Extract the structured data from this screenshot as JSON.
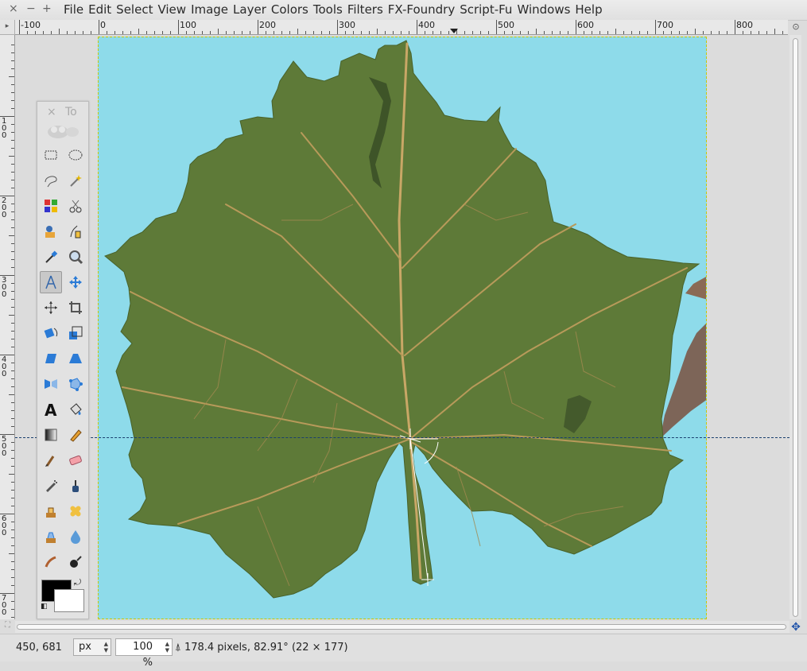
{
  "window_controls": [
    "×",
    "−",
    "+"
  ],
  "menu": [
    "File",
    "Edit",
    "Select",
    "View",
    "Image",
    "Layer",
    "Colors",
    "Tools",
    "Filters",
    "FX-Foundry",
    "Script-Fu",
    "Windows",
    "Help"
  ],
  "hruler_labels": [
    "-100",
    "0",
    "100",
    "200",
    "300",
    "400",
    "500",
    "600",
    "700",
    "800"
  ],
  "vruler_labels": [
    "100",
    "200",
    "300",
    "400",
    "500",
    "600",
    "700"
  ],
  "toolbox": {
    "close": "×",
    "title": "To",
    "tools": [
      "rect-select-tool-icon",
      "ellipse-select-tool-icon",
      "free-select-tool-icon",
      "fuzzy-select-tool-icon",
      "select-by-color-tool-icon",
      "scissors-select-tool-icon",
      "foreground-select-tool-icon",
      "paths-tool-icon",
      "color-picker-tool-icon",
      "zoom-tool-icon",
      "measure-tool-icon",
      "move-tool-icon",
      "align-tool-icon",
      "crop-tool-icon",
      "rotate-tool-icon",
      "scale-tool-icon",
      "shear-tool-icon",
      "perspective-tool-icon",
      "flip-tool-icon",
      "cage-transform-tool-icon",
      "text-tool-icon",
      "bucket-fill-tool-icon",
      "blend-tool-icon",
      "pencil-tool-icon",
      "paintbrush-tool-icon",
      "eraser-tool-icon",
      "airbrush-tool-icon",
      "ink-tool-icon",
      "clone-tool-icon",
      "heal-tool-icon",
      "perspective-clone-tool-icon",
      "blur-tool-icon",
      "smudge-tool-icon",
      "dodge-burn-tool-icon"
    ],
    "active_tool": "measure-tool-icon",
    "fg_color": "#000000",
    "bg_color": "#ffffff"
  },
  "status": {
    "coords": "450, 681",
    "unit": "px",
    "zoom": "100 %",
    "message": "178.4 pixels, 82.91° (22 × 177)"
  },
  "colors": {
    "canvas_bg": "#8edbea",
    "leaf": "#5e7a38",
    "vein": "#c9a766",
    "guide": "#1a3f6e"
  }
}
